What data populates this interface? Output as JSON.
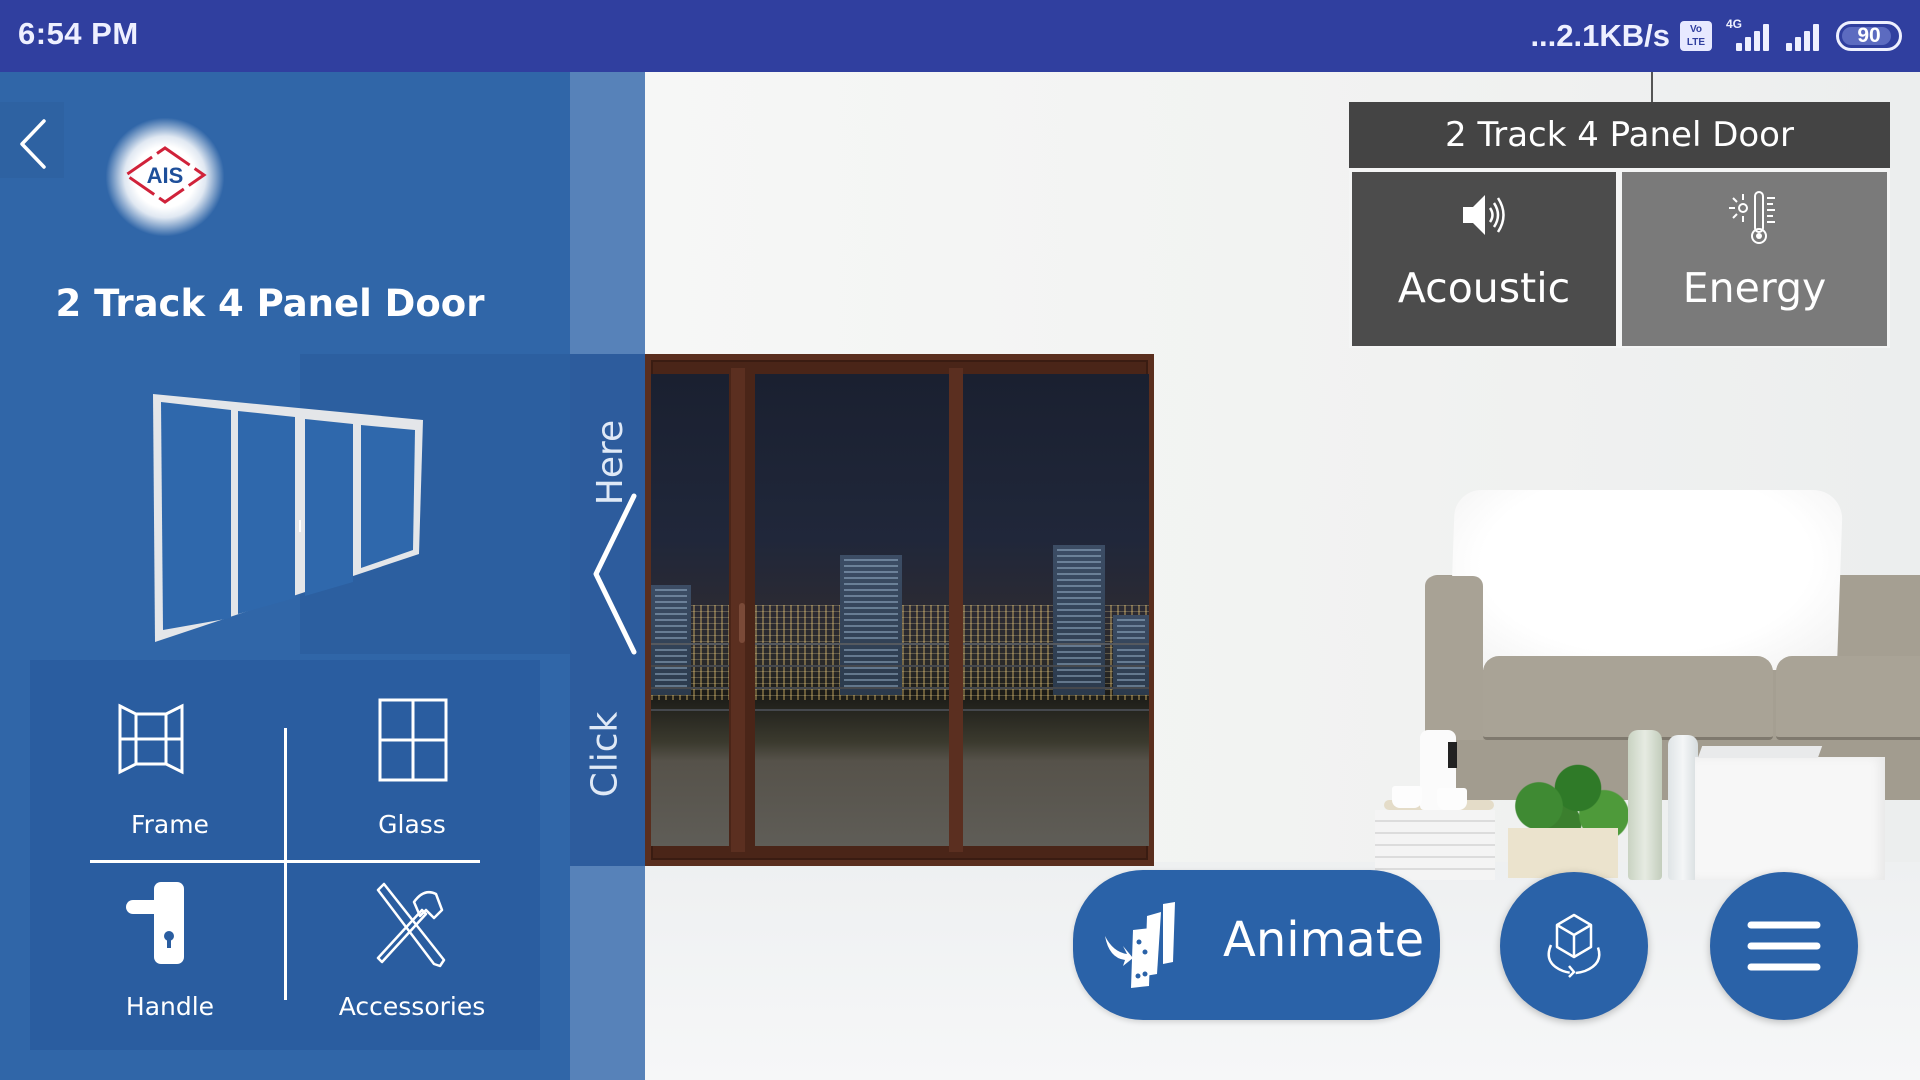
{
  "status_bar": {
    "time": "6:54 PM",
    "network_speed": "...2.1KB/s",
    "volte_top": "Vo",
    "volte_bottom": "LTE",
    "network_type": "4G",
    "battery_level": "90",
    "battery_percent": 90,
    "icons": [
      "volte-icon",
      "signal-4g-icon",
      "signal-icon",
      "battery-icon"
    ]
  },
  "left_panel": {
    "back_icon": "chevron-left-icon",
    "logo_text": "AIS",
    "title": "2 Track 4 Panel Door",
    "options": [
      {
        "label": "Frame",
        "icon": "frame-icon"
      },
      {
        "label": "Glass",
        "icon": "glass-icon"
      },
      {
        "label": "Handle",
        "icon": "handle-icon"
      },
      {
        "label": "Accessories",
        "icon": "tools-icon"
      }
    ]
  },
  "toggle_strip": {
    "text_top": "Here",
    "text_bottom": "Click",
    "icon": "chevron-left-icon"
  },
  "info_panel": {
    "title": "2 Track 4 Panel Door",
    "tiles": [
      {
        "label": "Acoustic",
        "icon": "speaker-icon"
      },
      {
        "label": "Energy",
        "icon": "thermometer-sun-icon"
      }
    ]
  },
  "actions": {
    "animate_label": "Animate",
    "animate_icon": "dominoes-icon",
    "view3d_icon": "rotate-3d-icon",
    "menu_icon": "hamburger-menu-icon"
  },
  "colors": {
    "status_bar": "#303f9f",
    "panel_blue": "#3066a8",
    "button_blue": "#2a62a8",
    "info_dark": "#444444",
    "frame_brown": "#5a2e1e",
    "logo_red": "#d0223a",
    "logo_blue": "#1e4f9a"
  }
}
